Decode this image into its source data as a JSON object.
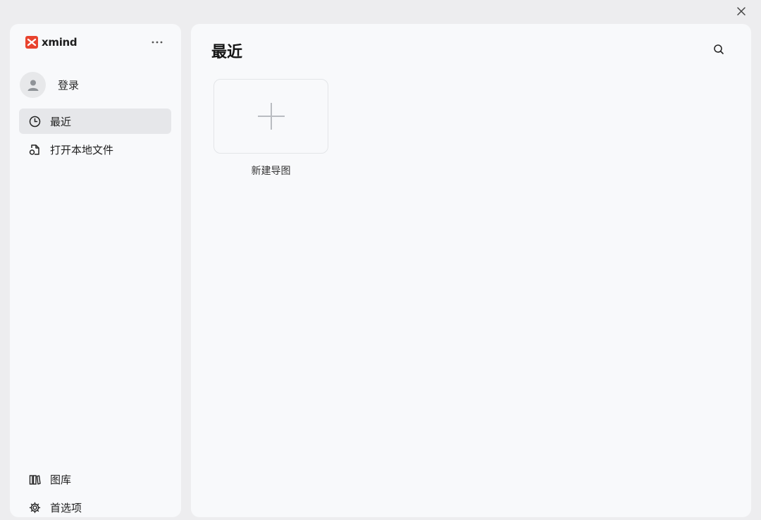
{
  "app": {
    "logo_text": "xmind",
    "brand_color": "#e8432e"
  },
  "sidebar": {
    "login_label": "登录",
    "nav": [
      {
        "label": "最近",
        "icon": "clock-icon",
        "active": true
      },
      {
        "label": "打开本地文件",
        "icon": "open-file-icon",
        "active": false
      }
    ],
    "bottom": [
      {
        "label": "图库",
        "icon": "library-icon"
      },
      {
        "label": "首选项",
        "icon": "gear-icon"
      }
    ]
  },
  "main": {
    "title": "最近",
    "new_map_label": "新建导图"
  }
}
